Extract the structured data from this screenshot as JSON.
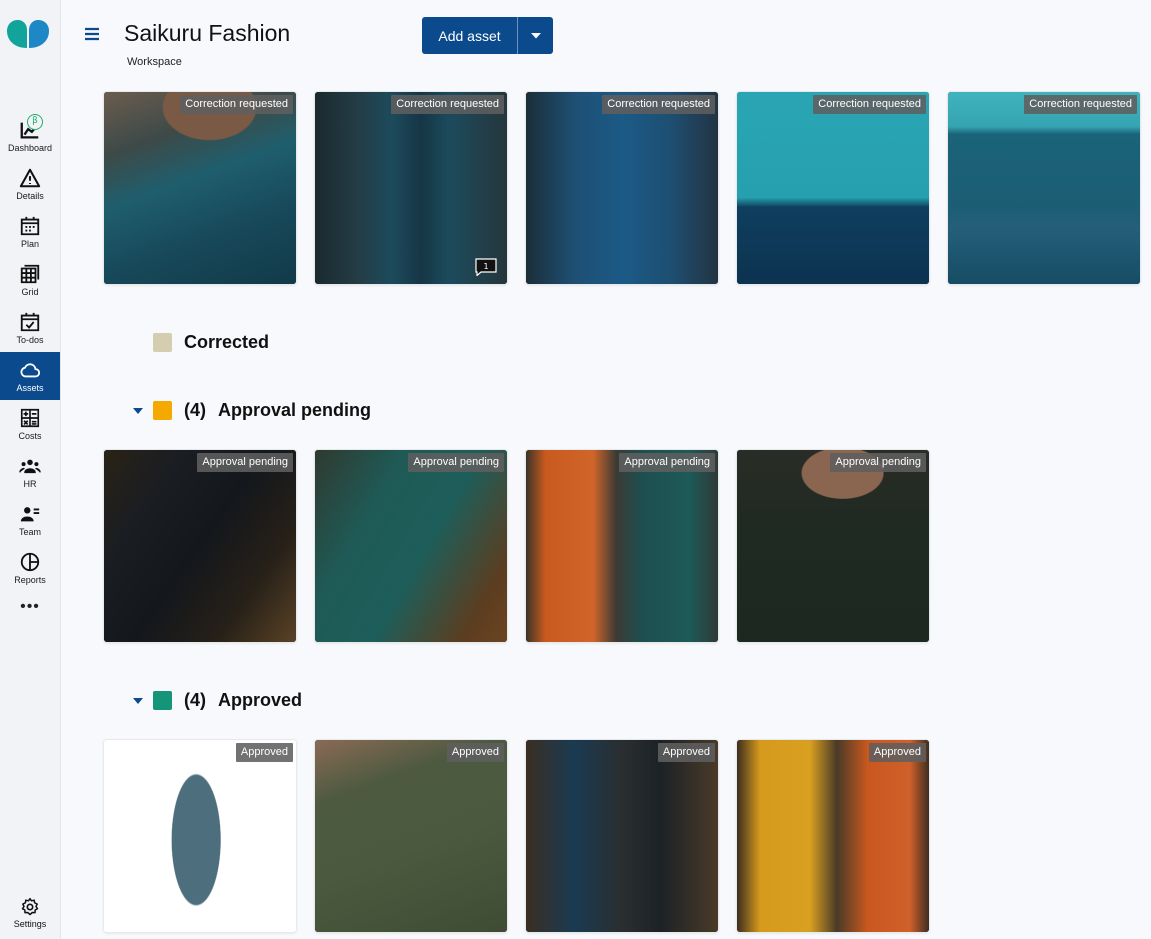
{
  "app": {
    "title": "Saikuru Fashion",
    "subtitle": "Workspace"
  },
  "nav": {
    "items": [
      {
        "label": "Dashboard",
        "icon": "dashboard-icon",
        "beta": "β"
      },
      {
        "label": "Details",
        "icon": "warning-triangle-icon"
      },
      {
        "label": "Plan",
        "icon": "calendar-icon"
      },
      {
        "label": "Grid",
        "icon": "grid-icon"
      },
      {
        "label": "To-dos",
        "icon": "todo-calendar-icon"
      },
      {
        "label": "Assets",
        "icon": "cloud-icon",
        "active": true
      },
      {
        "label": "Costs",
        "icon": "calculator-icon"
      },
      {
        "label": "HR",
        "icon": "people-group-icon"
      },
      {
        "label": "Team",
        "icon": "team-icon"
      },
      {
        "label": "Reports",
        "icon": "pie-chart-icon"
      }
    ],
    "more": "•••",
    "settings": "Settings"
  },
  "toolbar": {
    "add_asset": "Add asset"
  },
  "sections": {
    "correction": {
      "badge": "Correction requested",
      "comment_count": "1"
    },
    "corrected": {
      "name": "Corrected",
      "color": "#d4cdb0"
    },
    "pending": {
      "count": "(4)",
      "name": "Approval pending",
      "color": "#f5a800",
      "badge": "Approval pending"
    },
    "approved": {
      "count": "(4)",
      "name": "Approved",
      "color": "#14957a",
      "badge": "Approved"
    }
  },
  "colors": {
    "accent": "#0b4a8c"
  }
}
